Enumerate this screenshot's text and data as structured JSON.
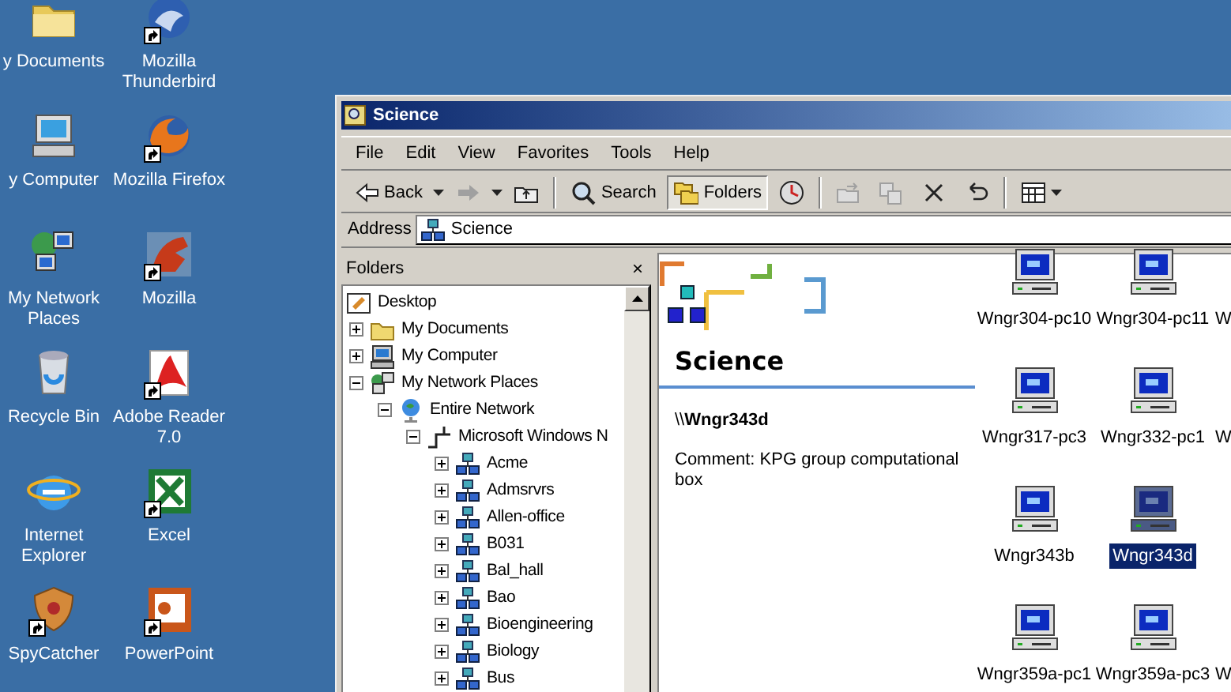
{
  "desktop_icons": [
    {
      "label": "y Documents",
      "kind": "folder",
      "shortcut": false
    },
    {
      "label": "Mozilla Thunderbird",
      "kind": "mail",
      "shortcut": true
    },
    {
      "label": "y Computer",
      "kind": "computer",
      "shortcut": false
    },
    {
      "label": "Mozilla Firefox",
      "kind": "fox",
      "shortcut": true
    },
    {
      "label": "My Network Places",
      "kind": "network",
      "shortcut": false
    },
    {
      "label": "Mozilla",
      "kind": "dragon",
      "shortcut": true
    },
    {
      "label": "Recycle Bin",
      "kind": "bin",
      "shortcut": false
    },
    {
      "label": "Adobe Reader 7.0",
      "kind": "pdf",
      "shortcut": true
    },
    {
      "label": "Internet Explorer",
      "kind": "ie",
      "shortcut": false
    },
    {
      "label": "Excel",
      "kind": "excel",
      "shortcut": true
    },
    {
      "label": "SpyCatcher",
      "kind": "shield",
      "shortcut": true
    },
    {
      "label": "PowerPoint",
      "kind": "ppt",
      "shortcut": true
    }
  ],
  "window": {
    "title": "Science"
  },
  "menu": [
    "File",
    "Edit",
    "View",
    "Favorites",
    "Tools",
    "Help"
  ],
  "toolbar": [
    {
      "kind": "back",
      "label": "Back",
      "disabled": false,
      "selected": false
    },
    {
      "kind": "forward",
      "disabled": true,
      "selected": false
    },
    {
      "kind": "up",
      "disabled": false,
      "selected": false
    },
    {
      "kind": "sep"
    },
    {
      "kind": "search",
      "label": "Search",
      "disabled": false,
      "selected": false
    },
    {
      "kind": "folders",
      "label": "Folders",
      "disabled": false,
      "selected": true
    },
    {
      "kind": "history",
      "disabled": false,
      "selected": false
    },
    {
      "kind": "sep"
    },
    {
      "kind": "moveto",
      "disabled": true,
      "selected": false
    },
    {
      "kind": "copyto",
      "disabled": true,
      "selected": false
    },
    {
      "kind": "delete",
      "disabled": false,
      "selected": false
    },
    {
      "kind": "undo",
      "disabled": false,
      "selected": false
    },
    {
      "kind": "sep"
    },
    {
      "kind": "views",
      "disabled": false,
      "selected": false
    }
  ],
  "address": {
    "label": "Address",
    "value": "Science"
  },
  "folders_pane": {
    "title": "Folders",
    "close": "×"
  },
  "tree": [
    {
      "label": "Desktop",
      "kind": "desktop",
      "children": [
        {
          "label": "My Documents",
          "kind": "folder",
          "expanded": false
        },
        {
          "label": "My Computer",
          "kind": "computer",
          "expanded": false
        },
        {
          "label": "My Network Places",
          "kind": "network",
          "expanded": true,
          "children": [
            {
              "label": "Entire Network",
              "kind": "globe",
              "expanded": true,
              "children": [
                {
                  "label": "Microsoft Windows N",
                  "kind": "mswin",
                  "expanded": true,
                  "children": [
                    {
                      "label": "Acme",
                      "kind": "workgroup",
                      "expanded": false
                    },
                    {
                      "label": "Admsrvrs",
                      "kind": "workgroup",
                      "expanded": false
                    },
                    {
                      "label": "Allen-office",
                      "kind": "workgroup",
                      "expanded": false
                    },
                    {
                      "label": "B031",
                      "kind": "workgroup",
                      "expanded": false
                    },
                    {
                      "label": "Bal_hall",
                      "kind": "workgroup",
                      "expanded": false
                    },
                    {
                      "label": "Bao",
                      "kind": "workgroup",
                      "expanded": false
                    },
                    {
                      "label": "Bioengineering",
                      "kind": "workgroup",
                      "expanded": false
                    },
                    {
                      "label": "Biology",
                      "kind": "workgroup",
                      "expanded": false
                    },
                    {
                      "label": "Bus",
                      "kind": "workgroup",
                      "expanded": false
                    }
                  ]
                }
              ]
            }
          ]
        }
      ]
    }
  ],
  "info": {
    "title": "Science",
    "name_prefix": "\\\\",
    "name": "Wngr343d",
    "comment": "Comment: KPG group computational box"
  },
  "computers": [
    [
      {
        "label": "Wngr304-pc10",
        "kind": "computer",
        "selected": false
      },
      {
        "label": "Wngr304-pc11",
        "kind": "computer",
        "selected": false
      },
      {
        "label": "W",
        "kind": "cut"
      }
    ],
    [
      {
        "label": "Wngr317-pc3",
        "kind": "computer",
        "selected": false
      },
      {
        "label": "Wngr332-pc1",
        "kind": "computer",
        "selected": false
      },
      {
        "label": "W",
        "kind": "cut"
      }
    ],
    [
      {
        "label": "Wngr343b",
        "kind": "computer",
        "selected": false
      },
      {
        "label": "Wngr343d",
        "kind": "computer",
        "selected": true
      }
    ],
    [
      {
        "label": "Wngr359a-pc1",
        "kind": "computer",
        "selected": false
      },
      {
        "label": "Wngr359a-pc3",
        "kind": "computer",
        "selected": false
      },
      {
        "label": "W",
        "kind": "cut"
      }
    ]
  ]
}
